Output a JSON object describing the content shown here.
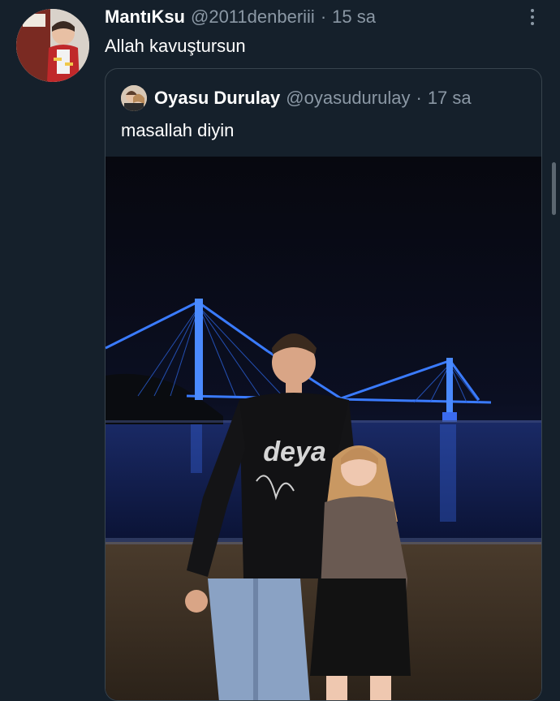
{
  "tweet": {
    "display_name": "MantıKsu",
    "handle": "@2011denberiii",
    "separator": "·",
    "time": "15 sa",
    "text": "Allah kavuştursun",
    "avatar_icon": "child-photo-avatar",
    "more_icon": "more-options-icon"
  },
  "quote": {
    "display_name": "Oyasu Durulay",
    "handle": "@oyasudurulay",
    "separator": "·",
    "time": "17 sa",
    "text": "masallah diyin",
    "avatar_icon": "user-photo-avatar",
    "photo": {
      "sweatshirt_print": "deya",
      "bridge_color": "#2f6bff"
    }
  },
  "colors": {
    "background": "#15202b",
    "secondary_text": "#8b98a5",
    "border": "#38444d"
  }
}
